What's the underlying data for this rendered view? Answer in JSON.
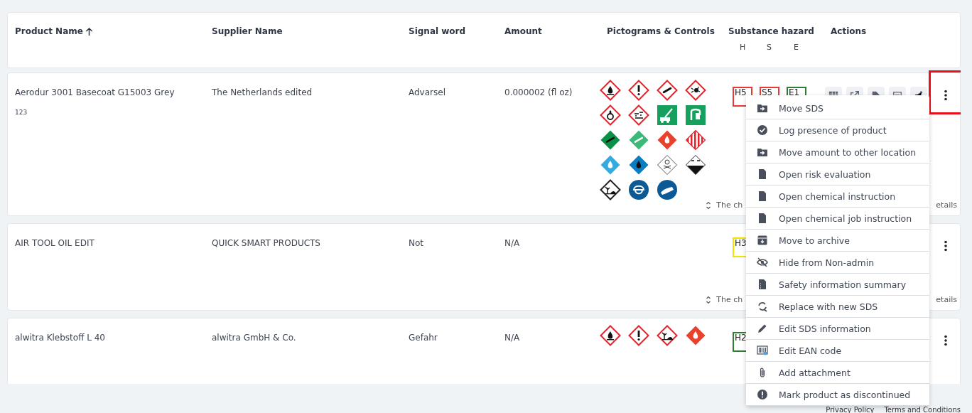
{
  "table": {
    "columns": [
      {
        "label": "Product Name",
        "sorted": true
      },
      {
        "label": "Supplier Name",
        "sorted": false
      },
      {
        "label": "Signal word",
        "sorted": false
      },
      {
        "label": "Amount",
        "sorted": false
      },
      {
        "label": "Pictograms & Controls",
        "sorted": false
      },
      {
        "label": "Substance hazard",
        "sorted": false
      },
      {
        "label": "Actions",
        "sorted": false
      }
    ],
    "hazard_subheaders": [
      "H",
      "S",
      "E"
    ],
    "rows": [
      {
        "product": "Aerodur 3001 Basecoat G15003 Grey",
        "code": "123",
        "supplier": "The Netherlands edited",
        "signal_word": "Advarsel",
        "amount": "0.000002 (fl oz)",
        "highlighted": true,
        "pictograms": [
          {
            "kind": "ghs-flame"
          },
          {
            "kind": "ghs-exclamation"
          },
          {
            "kind": "ghs-gas"
          },
          {
            "kind": "ghs-explosive"
          },
          {
            "kind": "ghs-oxidizer"
          },
          {
            "kind": "ghs-corrosive"
          },
          {
            "kind": "sign-escape"
          },
          {
            "kind": "sign-first-aid"
          },
          {
            "kind": "adr-gas-dark"
          },
          {
            "kind": "adr-gas-light"
          },
          {
            "kind": "adr-flame-red"
          },
          {
            "kind": "adr-striped"
          },
          {
            "kind": "adr-flame-lightblue"
          },
          {
            "kind": "adr-flame-blue"
          },
          {
            "kind": "adr-toxic"
          },
          {
            "kind": "adr-corrosive"
          },
          {
            "kind": "env-black"
          },
          {
            "kind": "mandatory-helmet"
          },
          {
            "kind": "mandatory-gloves"
          }
        ],
        "hazards": [
          {
            "label": "H5",
            "color": "#e53935"
          },
          {
            "label": "S5",
            "color": "#e53935"
          },
          {
            "label": "E1",
            "color": "#2e7d32"
          }
        ],
        "action_buttons": [
          {
            "kind": "table"
          },
          {
            "kind": "external"
          },
          {
            "kind": "tag"
          },
          {
            "kind": "document"
          },
          {
            "kind": "share"
          }
        ],
        "note_start": "The ch",
        "note_end": "etails"
      },
      {
        "product": "AIR TOOL OIL EDIT",
        "supplier": "QUICK SMART PRODUCTS",
        "signal_word": "Not",
        "amount": "N/A",
        "highlighted": false,
        "pictograms": [],
        "hazards": [
          {
            "label": "H3",
            "color": "#f5e100"
          }
        ],
        "action_buttons": [],
        "note_start": "The ch",
        "note_end": "etails"
      },
      {
        "product": "alwitra Klebstoff L 40",
        "supplier": "alwitra GmbH & Co.",
        "signal_word": "Gefahr",
        "amount": "N/A",
        "highlighted": false,
        "pictograms": [
          {
            "kind": "ghs-flame"
          },
          {
            "kind": "ghs-exclamation"
          },
          {
            "kind": "ghs-environment"
          },
          {
            "kind": "adr-flame-red"
          }
        ],
        "hazards": [
          {
            "label": "H2",
            "color": "#2e7d32"
          }
        ],
        "action_buttons": []
      }
    ]
  },
  "context_menu": [
    {
      "label": "Move SDS",
      "kind": "folder-move"
    },
    {
      "label": "Log presence of product",
      "kind": "check-circle"
    },
    {
      "label": "Move amount to other location",
      "kind": "folder-move"
    },
    {
      "label": "Open risk evaluation",
      "kind": "document"
    },
    {
      "label": "Open chemical instruction",
      "kind": "document"
    },
    {
      "label": "Open chemical job instruction",
      "kind": "document"
    },
    {
      "label": "Move to archive",
      "kind": "archive"
    },
    {
      "label": "Hide from Non-admin",
      "kind": "eye-off"
    },
    {
      "label": "Safety information summary",
      "kind": "summary"
    },
    {
      "label": "Replace with new SDS",
      "kind": "replace"
    },
    {
      "label": "Edit SDS information",
      "kind": "pencil"
    },
    {
      "label": "Edit EAN code",
      "kind": "barcode"
    },
    {
      "label": "Add attachment",
      "kind": "paperclip"
    },
    {
      "label": "Mark product as discontinued",
      "kind": "alert-circle"
    }
  ],
  "footer": {
    "links": [
      "Privacy Policy",
      "Terms and Conditions"
    ]
  }
}
